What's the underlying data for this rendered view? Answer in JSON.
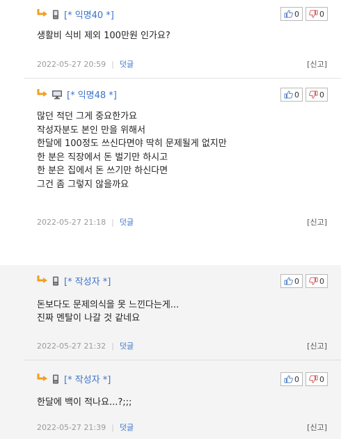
{
  "vote_up_icon": "thumbs-up-icon",
  "vote_down_icon": "thumbs-down-icon",
  "comments": [
    {
      "author": "[* 익명40 *]",
      "device": "mobile",
      "up": "0",
      "down": "0",
      "lines": [
        "생활비 식비 제외 100만원 인가요?"
      ],
      "date": "2022-05-27 20:59",
      "reply_label": "덧글",
      "report_label": "[신고]"
    },
    {
      "author": "[* 익명48 *]",
      "device": "desktop",
      "up": "0",
      "down": "0",
      "lines": [
        "많던 적던 그게 중요한가요",
        "작성자분도 본인 만을 위해서",
        "한달에 100정도 쓰신다면야 딱히 문제될게 없지만",
        "한 분은 직장에서 돈 벌기만 하시고",
        "한 분은 집에서 돈 쓰기만 하신다면",
        "그건 좀 그렇지 않을까요"
      ],
      "date": "2022-05-27 21:18",
      "reply_label": "덧글",
      "report_label": "[신고]"
    },
    {
      "author": "[* 작성자 *]",
      "device": "mobile",
      "up": "0",
      "down": "0",
      "lines": [
        "돈보다도 문제의식을 못 느낀다는게...",
        "진짜 멘탈이 나갈 것 같네요"
      ],
      "date": "2022-05-27 21:32",
      "reply_label": "덧글",
      "report_label": "[신고]"
    },
    {
      "author": "[* 작성자 *]",
      "device": "mobile",
      "up": "0",
      "down": "0",
      "lines": [
        "한달에 백이 적나요...?;;;"
      ],
      "date": "2022-05-27 21:39",
      "reply_label": "덧글",
      "report_label": "[신고]"
    }
  ]
}
